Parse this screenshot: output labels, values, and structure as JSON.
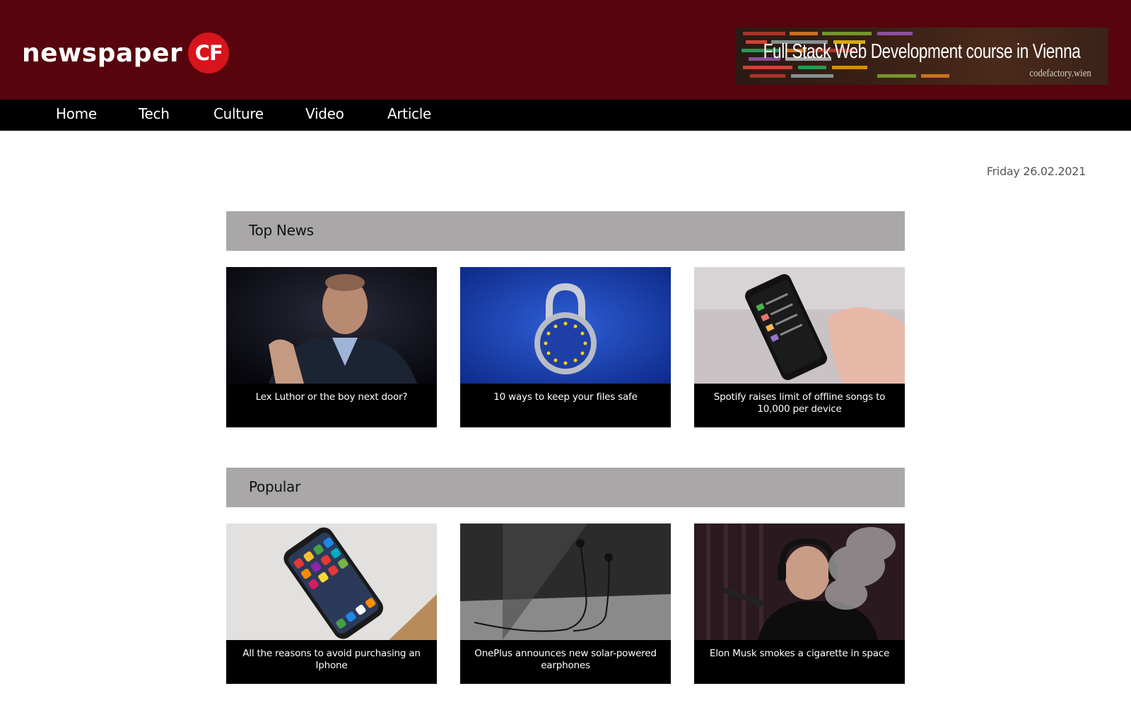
{
  "brand": {
    "word": "newspaper",
    "badge": "CF"
  },
  "banner": {
    "title": "Full Stack Web Development course in Vienna",
    "subtitle": "codefactory.wien"
  },
  "nav": {
    "items": [
      "Home",
      "Tech",
      "Culture",
      "Video",
      "Article"
    ]
  },
  "date": "Friday 26.02.2021",
  "sections": [
    {
      "title": "Top News",
      "articles": [
        {
          "caption": "Lex Luthor or the boy next door?",
          "image": "portrait-speaker"
        },
        {
          "caption": "10 ways to keep your files safe",
          "image": "padlock-eu"
        },
        {
          "caption": "Spotify raises limit of offline songs to 10,000 per device",
          "image": "hand-phone"
        }
      ]
    },
    {
      "title": "Popular",
      "articles": [
        {
          "caption": "All the reasons to avoid purchasing an Iphone",
          "image": "iphone-table"
        },
        {
          "caption": "OnePlus announces new solar-powered earphones",
          "image": "earphones"
        },
        {
          "caption": "Elon Musk smokes a cigarette in space",
          "image": "smoking-man"
        }
      ]
    }
  ],
  "colors": {
    "header_bg": "#57040d",
    "nav_bg": "#000000",
    "section_header_bg": "#aaa7a8",
    "logo_badge": "#d8141c"
  }
}
